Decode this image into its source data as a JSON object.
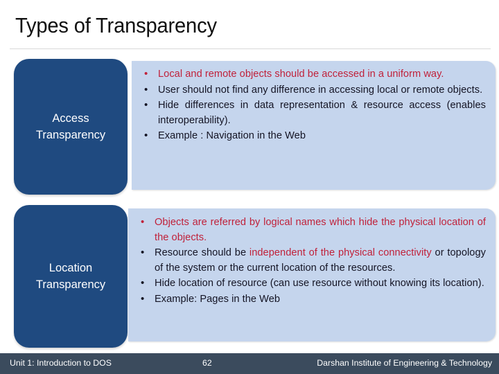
{
  "slide": {
    "title": "Types of Transparency",
    "accent_navy": "#1f4a80",
    "panel_blue": "#c5d5ed",
    "highlight_red": "#c0213a",
    "footer_bg": "#3b4b5d"
  },
  "sections": [
    {
      "label_line1": "Access",
      "label_line2": "Transparency",
      "bullets": [
        {
          "red": true,
          "text": "Local and remote objects should be accessed in a uniform way."
        },
        {
          "red": false,
          "text": "User should not find any difference in accessing local or remote objects."
        },
        {
          "red": false,
          "text": "Hide differences in data representation & resource access (enables interoperability)."
        },
        {
          "red": false,
          "text": "Example : Navigation in the Web"
        }
      ]
    },
    {
      "label_line1": "Location",
      "label_line2": "Transparency",
      "bullets": [
        {
          "red": true,
          "text": "Objects are referred by logical names which hide the physical location of the objects."
        },
        {
          "red": false,
          "pre": "Resource should be ",
          "highlight": "independent of the physical connectivity",
          "post": " or topology of the system or the current location of the resources."
        },
        {
          "red": false,
          "text": "Hide location of resource (can use resource without knowing its location)."
        },
        {
          "red": false,
          "text": "Example: Pages in the Web"
        }
      ]
    }
  ],
  "footer": {
    "left": "Unit 1: Introduction to DOS",
    "page": "62",
    "right": "Darshan Institute of Engineering & Technology"
  }
}
